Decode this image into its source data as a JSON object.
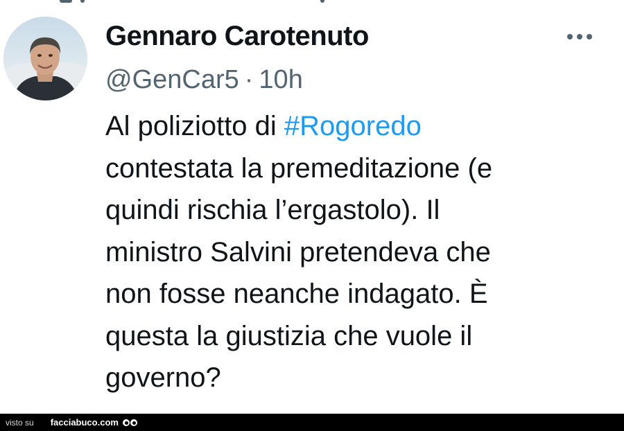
{
  "tweet": {
    "author_name": "Gennaro Carotenuto",
    "handle": "@GenCar5",
    "separator": "·",
    "time": "10h",
    "more_icon": "more-horizontal-icon",
    "text_lines": [
      {
        "before": "Al poliziotto di ",
        "hashtag": "#Rogoredo"
      },
      {
        "text": "contestata la premeditazione (e"
      },
      {
        "text": "quindi rischia l’ergastolo). Il"
      },
      {
        "text": "ministro Salvini pretendeva che"
      },
      {
        "text": "non fosse neanche indagato. È"
      },
      {
        "text": "questa la giustizia che vuole il"
      },
      {
        "text": "governo?"
      }
    ]
  },
  "watermark": {
    "prefix": "visto su",
    "site": "facciabuco.com",
    "icon": "eyes-icon"
  },
  "colors": {
    "text": "#0f1419",
    "secondary": "#536471",
    "link": "#1d9bf0",
    "footer_bg": "#000000"
  }
}
